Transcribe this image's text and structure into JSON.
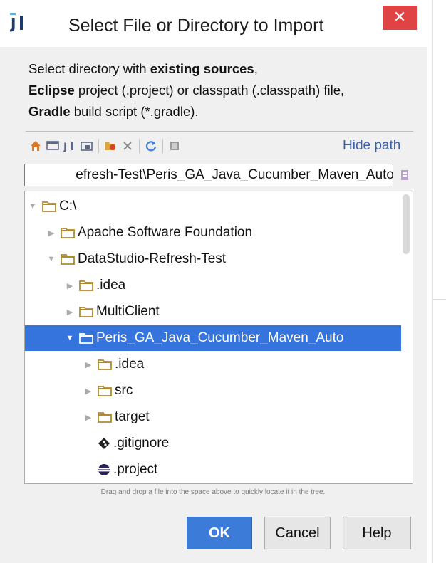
{
  "window": {
    "title": "Select File or Directory to Import",
    "close_label": "✕"
  },
  "description": {
    "line1_pre": "Select directory with ",
    "line1_bold": "existing sources",
    "line1_post": ",",
    "line2_bold": "Eclipse",
    "line2_post": " project (.project) or classpath (.classpath) file,",
    "line3_bold": "Gradle",
    "line3_post": " build script (*.gradle)."
  },
  "toolbar": {
    "hide_path_label": "Hide path"
  },
  "path": {
    "value": "efresh-Test\\Peris_GA_Java_Cucumber_Maven_Auto"
  },
  "tree": {
    "rows": [
      {
        "label": "C:\\",
        "level": 0,
        "kind": "folder",
        "expanded": true
      },
      {
        "label": "Apache Software Foundation",
        "level": 1,
        "kind": "folder",
        "expanded": false
      },
      {
        "label": "DataStudio-Refresh-Test",
        "level": 1,
        "kind": "folder",
        "expanded": true
      },
      {
        "label": ".idea",
        "level": 2,
        "kind": "folder",
        "expanded": false
      },
      {
        "label": "MultiClient",
        "level": 2,
        "kind": "folder",
        "expanded": false
      },
      {
        "label": "Peris_GA_Java_Cucumber_Maven_Auto",
        "level": 2,
        "kind": "folder",
        "expanded": true,
        "selected": true
      },
      {
        "label": ".idea",
        "level": 3,
        "kind": "folder",
        "expanded": false
      },
      {
        "label": "src",
        "level": 3,
        "kind": "folder",
        "expanded": false
      },
      {
        "label": "target",
        "level": 3,
        "kind": "folder",
        "expanded": false
      },
      {
        "label": ".gitignore",
        "level": 3,
        "kind": "git-file"
      },
      {
        "label": ".project",
        "level": 3,
        "kind": "eclipse-file"
      }
    ]
  },
  "hint": "Drag and drop a file into the space above to quickly locate it in the tree.",
  "buttons": {
    "ok": "OK",
    "cancel": "Cancel",
    "help": "Help"
  },
  "colors": {
    "selection": "#3474dc",
    "close": "#e04343",
    "link": "#3b5fa8",
    "folder": "#b08a2e"
  }
}
